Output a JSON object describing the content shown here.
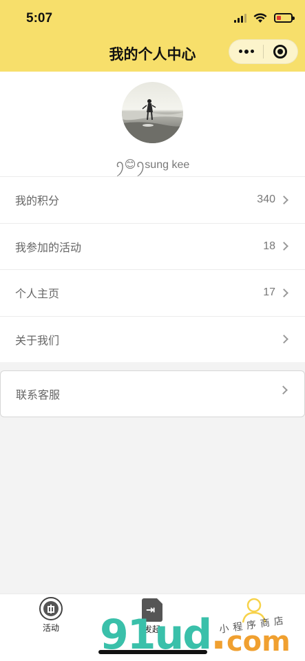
{
  "status_bar": {
    "time": "5:07",
    "battery_level": 0.3
  },
  "nav": {
    "title": "我的个人中心"
  },
  "profile": {
    "username": "ꪆ😊ꪆsung kee"
  },
  "menu": [
    {
      "label": "我的积分",
      "value": "340"
    },
    {
      "label": "我参加的活动",
      "value": "18"
    },
    {
      "label": "个人主页",
      "value": "17"
    },
    {
      "label": "关于我们",
      "value": ""
    }
  ],
  "service": {
    "label": "联系客服"
  },
  "tabbar": {
    "tabs": [
      {
        "label": "活动",
        "icon": "gift-icon"
      },
      {
        "label": "发起",
        "icon": "document-icon"
      },
      {
        "label": "",
        "icon": "person-icon",
        "active": true
      }
    ],
    "active_color": "#f7d24a"
  },
  "watermark": {
    "brand": "91ud",
    "dot": ".",
    "tld": "com",
    "script": "小程序商店"
  },
  "colors": {
    "header": "#f7df6b",
    "background": "#f3f3f3"
  }
}
